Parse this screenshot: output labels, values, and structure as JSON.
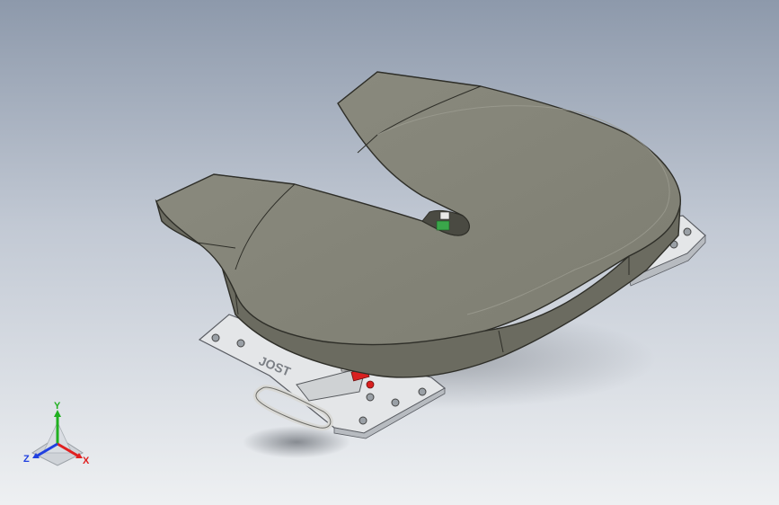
{
  "scene": {
    "colors": {
      "background_top": "#8d99ab",
      "background_bottom": "#eef0f2",
      "plate_top": "#8a8a7d",
      "plate_side": "#6b6b60",
      "plate_edge": "#3b3b34",
      "base_plate": "#e4e6e8",
      "handle_ring": "#d9d9d6",
      "lock_red": "#d92020",
      "accent_green": "#3aa64a"
    },
    "icons": {
      "fifth_wheel": "fifth-wheel-coupling-model",
      "triad": "view-orientation-triad-icon"
    }
  },
  "triad": {
    "y_label": "Y",
    "z_label": "Z",
    "x_label": "X",
    "colors": {
      "x": "#e02020",
      "y": "#20b020",
      "z": "#2040e0"
    }
  },
  "base": {
    "engraving": "JOST"
  }
}
